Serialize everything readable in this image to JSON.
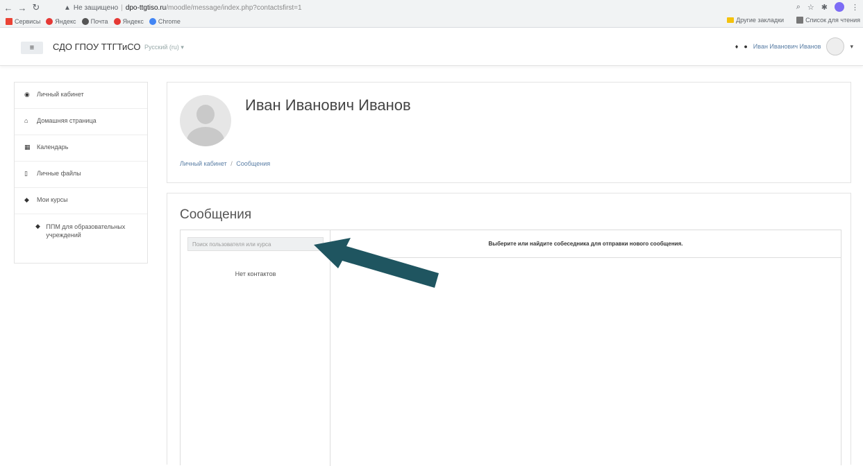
{
  "browser": {
    "warn_label": "Не защищено",
    "host": "dpo-ttgtiso.ru",
    "path": "/moodle/message/index.php?contactsfirst=1",
    "bookmarks": [
      {
        "label": "Сервисы",
        "color": "#ea4335"
      },
      {
        "label": "Яндекс",
        "color": "#e53935"
      },
      {
        "label": "Почта",
        "color": "#555555"
      },
      {
        "label": "Яндекс",
        "color": "#e53935"
      },
      {
        "label": "Chrome",
        "color": "#4285f4"
      }
    ],
    "bookmarks_right": {
      "other": "Другие закладки",
      "reading": "Список для чтения"
    }
  },
  "navbar": {
    "menu_icon": "≡",
    "site_name": "СДО ГПОУ ТТГТиСО",
    "language": "Русский (ru) ▾",
    "user_name": "Иван Иванович Иванов"
  },
  "sidebar": {
    "items": [
      {
        "icon": "dashboard-icon",
        "glyph": "◉",
        "label": "Личный кабинет"
      },
      {
        "icon": "home-icon",
        "glyph": "⌂",
        "label": "Домашняя страница"
      },
      {
        "icon": "calendar-icon",
        "glyph": "▦",
        "label": "Календарь"
      },
      {
        "icon": "file-icon",
        "glyph": "▯",
        "label": "Личные файлы"
      },
      {
        "icon": "graduation-cap-icon",
        "glyph": "◆",
        "label": "Мои курсы"
      }
    ],
    "course": {
      "glyph": "◆",
      "label": "ППМ для образовательных учреждений"
    }
  },
  "header": {
    "name": "Иван Иванович Иванов",
    "breadcrumb": [
      "Личный кабинет",
      "Сообщения"
    ]
  },
  "messages": {
    "title": "Сообщения",
    "search_placeholder": "Поиск пользователя или курса",
    "no_contacts": "Нет контактов",
    "prompt": "Выберите или найдите собеседника для отправки нового сообщения."
  },
  "colors": {
    "arrow": "#1f5560",
    "link": "#5a7ea5"
  }
}
